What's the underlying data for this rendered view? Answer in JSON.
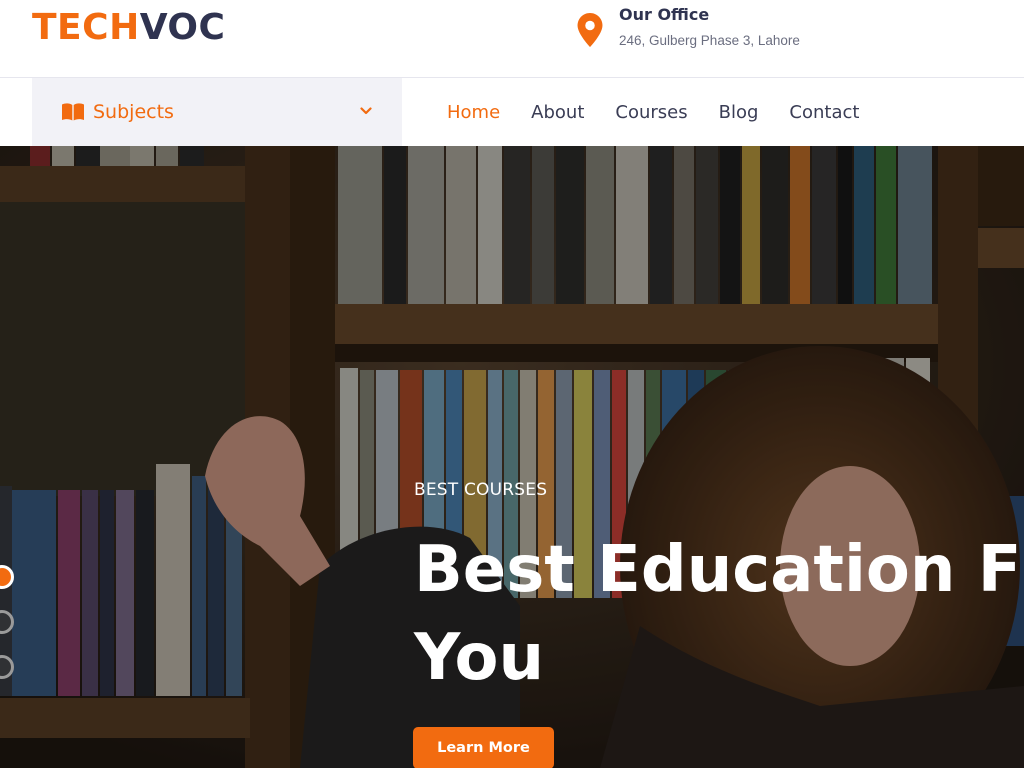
{
  "brand": {
    "part1": "TECH",
    "part2": "VOC"
  },
  "office": {
    "title": "Our Office",
    "address": "246, Gulberg Phase 3, Lahore",
    "icon": "map-pin-icon"
  },
  "subjects": {
    "label": "Subjects",
    "icon": "book-icon",
    "chevron": "chevron-down-icon"
  },
  "nav": {
    "items": [
      "Home",
      "About",
      "Courses",
      "Blog",
      "Contact"
    ],
    "active": "Home"
  },
  "hero": {
    "eyebrow": "BEST COURSES",
    "headline_line1": "Best Education F",
    "headline_line2": "You",
    "cta": "Learn More",
    "slides": 3,
    "active_slide": 1
  },
  "colors": {
    "accent": "#f26b10",
    "dark": "#2f3350",
    "subjects_bg": "#f2f2f7"
  }
}
